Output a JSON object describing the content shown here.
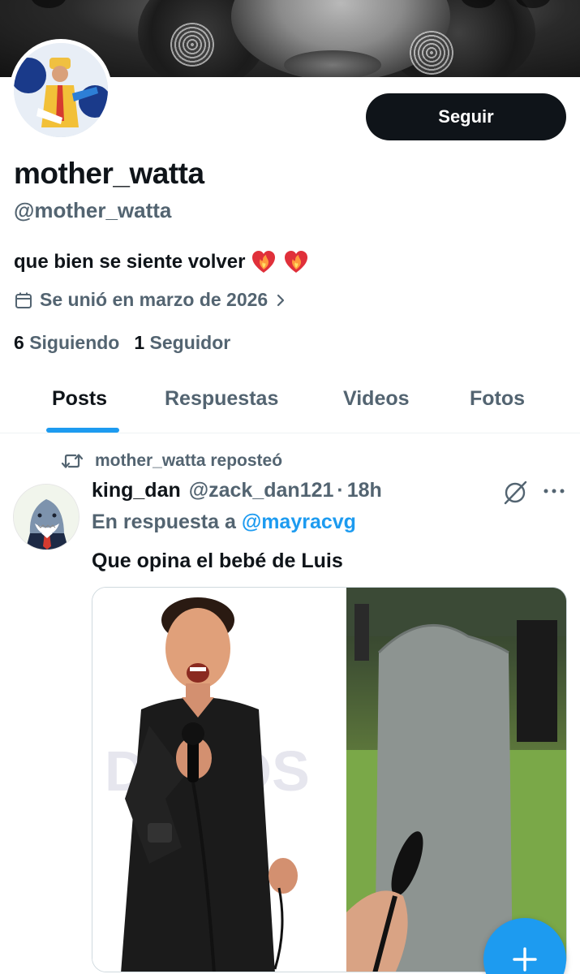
{
  "profile": {
    "follow_label": "Seguir",
    "display_name": "mother_watta",
    "handle": "@mother_watta",
    "bio_text": "que bien se siente volver",
    "joined": "Se unió en marzo de 2026",
    "following_count": "6",
    "following_label": "Siguiendo",
    "followers_count": "1",
    "followers_label": "Seguidor"
  },
  "tabs": [
    {
      "label": "Posts",
      "active": true
    },
    {
      "label": "Respuestas",
      "active": false
    },
    {
      "label": "Videos",
      "active": false
    },
    {
      "label": "Fotos",
      "active": false
    }
  ],
  "post": {
    "repost_label": "mother_watta reposteó",
    "author_name": "king_dan",
    "author_handle": "@zack_dan121",
    "separator": "·",
    "time": "18h",
    "reply_prefix": "En respuesta a",
    "reply_mention": "@mayracvg",
    "text": "Que opina el bebé de Luis",
    "watermark": "DONDS"
  },
  "colors": {
    "accent": "#1d9bf0",
    "text_primary": "#0f1419",
    "text_secondary": "#536471",
    "button_dark": "#0f1419"
  },
  "icons": {
    "calendar": "calendar-icon",
    "chevron": "chevron-right-icon",
    "repost": "repost-icon",
    "grok": "grok-icon",
    "more": "more-icon",
    "compose": "plus-icon",
    "heart": "heart-on-fire-emoji"
  }
}
